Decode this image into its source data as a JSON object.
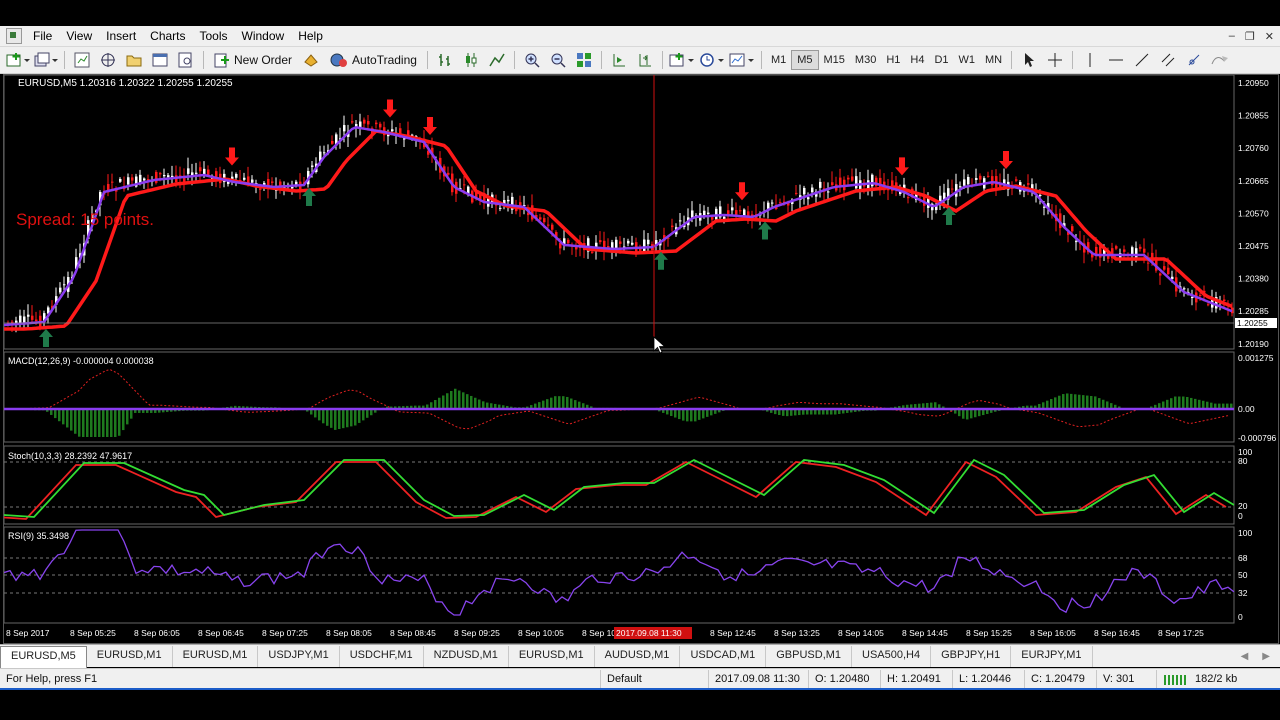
{
  "menu": [
    "File",
    "View",
    "Insert",
    "Charts",
    "Tools",
    "Window",
    "Help"
  ],
  "toolbar": {
    "new_order": "New Order",
    "autotrading": "AutoTrading",
    "timeframes": [
      "M1",
      "M5",
      "M15",
      "M30",
      "H1",
      "H4",
      "D1",
      "W1",
      "MN"
    ],
    "active_timeframe": "M5"
  },
  "chart": {
    "header": "EURUSD,M5  1.20316 1.20322 1.20255 1.20255",
    "spread_label": "Spread: 15 points.",
    "current_price": "1.20255",
    "price_ticks": [
      "1.20950",
      "1.20855",
      "1.20760",
      "1.20665",
      "1.20570",
      "1.20475",
      "1.20380",
      "1.20285",
      "1.20190"
    ],
    "cursor_time": "2017.09.08 11:30",
    "time_ticks": [
      "8 Sep 2017",
      "8 Sep 05:25",
      "8 Sep 06:05",
      "8 Sep 06:45",
      "8 Sep 07:25",
      "8 Sep 08:05",
      "8 Sep 08:45",
      "8 Sep 09:25",
      "8 Sep 10:05",
      "8 Sep 10",
      "8 Sep 12:05",
      "8 Sep 12:45",
      "8 Sep 13:25",
      "8 Sep 14:05",
      "8 Sep 14:45",
      "8 Sep 15:25",
      "8 Sep 16:05",
      "8 Sep 16:45",
      "8 Sep 17:25"
    ],
    "colors": {
      "bull": "#ffffff",
      "bear": "#ff1a1a",
      "ma_fast": "#8a3cf0",
      "ma_slow": "#ff1a1a",
      "arrow_up": "#1f7a4a",
      "arrow_down": "#ff1a1a",
      "macd_hist": "#1e7a1e",
      "stoch_main": "#33dd33",
      "stoch_signal": "#ee2222",
      "rsi": "#8844ee"
    }
  },
  "macd": {
    "label": "MACD(12,26,9) -0.000004 0.000038",
    "top": "0.001275",
    "zero": "0.00",
    "bottom": "-0.000796"
  },
  "stoch": {
    "label": "Stoch(10,3,3) 28.2392 47.9617",
    "levels": [
      "100",
      "80",
      "20",
      "0"
    ]
  },
  "rsi": {
    "label": "RSI(9) 35.3498",
    "levels": [
      "100",
      "68",
      "50",
      "32",
      "0"
    ]
  },
  "tabs": [
    "EURUSD,M5",
    "EURUSD,M1",
    "EURUSD,M1",
    "USDJPY,M1",
    "USDCHF,M1",
    "NZDUSD,M1",
    "EURUSD,M1",
    "AUDUSD,M1",
    "USDCAD,M1",
    "GBPUSD,M1",
    "USA500,H4",
    "GBPJPY,H1",
    "EURJPY,M1"
  ],
  "status": {
    "help": "For Help, press F1",
    "profile": "Default",
    "datetime": "2017.09.08 11:30",
    "open": "O: 1.20480",
    "high": "H: 1.20491",
    "low": "L: 1.20446",
    "close": "C: 1.20479",
    "volume": "V: 301",
    "traffic": "182/2 kb"
  }
}
